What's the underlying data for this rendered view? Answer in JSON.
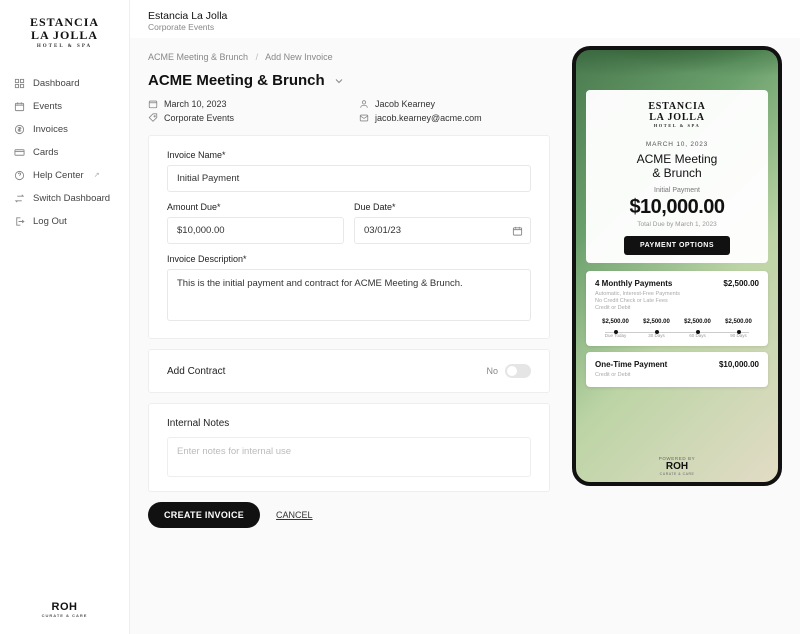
{
  "brand": {
    "line1": "ESTANCIA",
    "line2": "LA JOLLA",
    "sub": "HOTEL & SPA"
  },
  "nav": {
    "items": [
      {
        "label": "Dashboard"
      },
      {
        "label": "Events"
      },
      {
        "label": "Invoices"
      },
      {
        "label": "Cards"
      },
      {
        "label": "Help Center"
      },
      {
        "label": "Switch Dashboard"
      },
      {
        "label": "Log Out"
      }
    ]
  },
  "footer_brand": {
    "name": "ROH",
    "sub": "CURATE & CARE"
  },
  "topbar": {
    "title": "Estancia La Jolla",
    "sub": "Corporate Events"
  },
  "crumbs": {
    "parent": "ACME Meeting & Brunch",
    "current": "Add New Invoice"
  },
  "page": {
    "title": "ACME Meeting & Brunch"
  },
  "meta": {
    "date": "March 10, 2023",
    "contact_name": "Jacob Kearney",
    "category": "Corporate Events",
    "contact_email": "jacob.kearney@acme.com"
  },
  "form": {
    "labels": {
      "invoice_name": "Invoice Name*",
      "amount_due": "Amount Due*",
      "due_date": "Due Date*",
      "description": "Invoice Description*",
      "add_contract": "Add Contract",
      "internal_notes": "Internal Notes"
    },
    "values": {
      "invoice_name": "Initial Payment",
      "amount_due": "$10,000.00",
      "due_date": "03/01/23",
      "description": "This is the initial payment and contract for ACME Meeting & Brunch."
    },
    "toggle": {
      "state_label": "No"
    },
    "notes_placeholder": "Enter notes for internal use",
    "actions": {
      "create": "CREATE INVOICE",
      "cancel": "CANCEL"
    }
  },
  "preview": {
    "brand": {
      "line1": "ESTANCIA",
      "line2": "LA JOLLA",
      "sub": "HOTEL & SPA"
    },
    "date": "MARCH 10, 2023",
    "event_line1": "ACME Meeting",
    "event_line2": "& Brunch",
    "payment_name": "Initial Payment",
    "amount": "$10,000.00",
    "total_due": "Total Due by March 1, 2023",
    "options_btn": "PAYMENT OPTIONS",
    "option_monthly": {
      "title": "4 Monthly Payments",
      "amount": "$2,500.00",
      "sub1": "Automatic, Interest-Free Payments",
      "sub2": "No Credit Check or Late Fees",
      "sub3": "Credit or Debit",
      "schedule": [
        {
          "amt": "$2,500.00",
          "lbl": "Due Today"
        },
        {
          "amt": "$2,500.00",
          "lbl": "30 Days"
        },
        {
          "amt": "$2,500.00",
          "lbl": "60 Days"
        },
        {
          "amt": "$2,500.00",
          "lbl": "90 Days"
        }
      ]
    },
    "option_onetime": {
      "title": "One-Time Payment",
      "amount": "$10,000.00",
      "sub": "Credit or Debit"
    },
    "powered": "POWERED BY",
    "footer": {
      "name": "ROH",
      "sub": "CURATE & CARE"
    }
  }
}
